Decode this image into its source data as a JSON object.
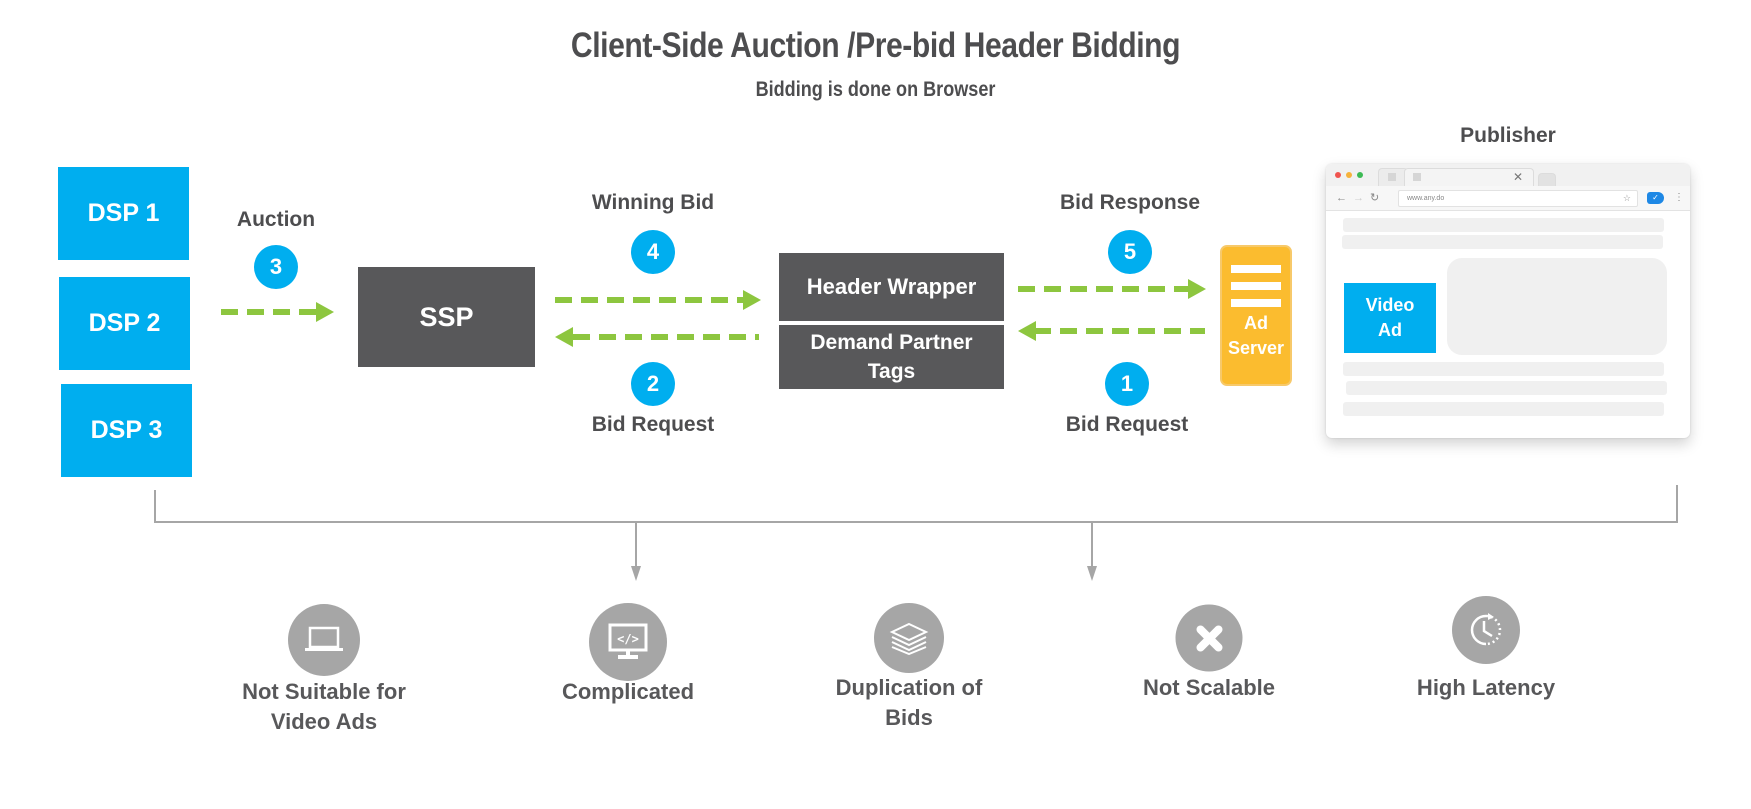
{
  "header": {
    "title": "Client-Side Auction /Pre-bid Header Bidding",
    "subtitle": "Bidding is done on Browser"
  },
  "colors": {
    "dsp_blue": "#00aeef",
    "dark_box": "#58585a",
    "arrow_green": "#8dc63f",
    "ad_server_yellow": "#fbbc2f",
    "issue_gray": "#a6a6a6",
    "text_dark": "#4d4d4f"
  },
  "dsps": [
    {
      "label": "DSP 1"
    },
    {
      "label": "DSP 2"
    },
    {
      "label": "DSP 3"
    }
  ],
  "nodes": {
    "ssp": "SSP",
    "header_wrapper": "Header Wrapper",
    "demand_partner_tags_line1": "Demand Partner",
    "demand_partner_tags_line2": "Tags",
    "ad_server_line1": "Ad",
    "ad_server_line2": "Server",
    "publisher": "Publisher"
  },
  "steps": [
    {
      "number": "1",
      "label": "Bid Request",
      "direction": "ad-server-to-header-wrapper"
    },
    {
      "number": "2",
      "label": "Bid Request",
      "direction": "header-wrapper-to-ssp"
    },
    {
      "number": "3",
      "label": "Auction",
      "direction": "dsp-to-ssp"
    },
    {
      "number": "4",
      "label": "Winning Bid",
      "direction": "ssp-to-header-wrapper"
    },
    {
      "number": "5",
      "label": "Bid Response",
      "direction": "header-wrapper-to-ad-server"
    }
  ],
  "browser": {
    "url": "www.any.do",
    "video_ad_line1": "Video",
    "video_ad_line2": "Ad"
  },
  "issues": [
    {
      "icon": "laptop-icon",
      "line1": "Not Suitable for",
      "line2": "Video Ads"
    },
    {
      "icon": "code-monitor-icon",
      "line1": "Complicated",
      "line2": ""
    },
    {
      "icon": "layers-icon",
      "line1": "Duplication of",
      "line2": "Bids"
    },
    {
      "icon": "x-icon",
      "line1": "Not Scalable",
      "line2": ""
    },
    {
      "icon": "clock-icon",
      "line1": "High Latency",
      "line2": ""
    }
  ]
}
